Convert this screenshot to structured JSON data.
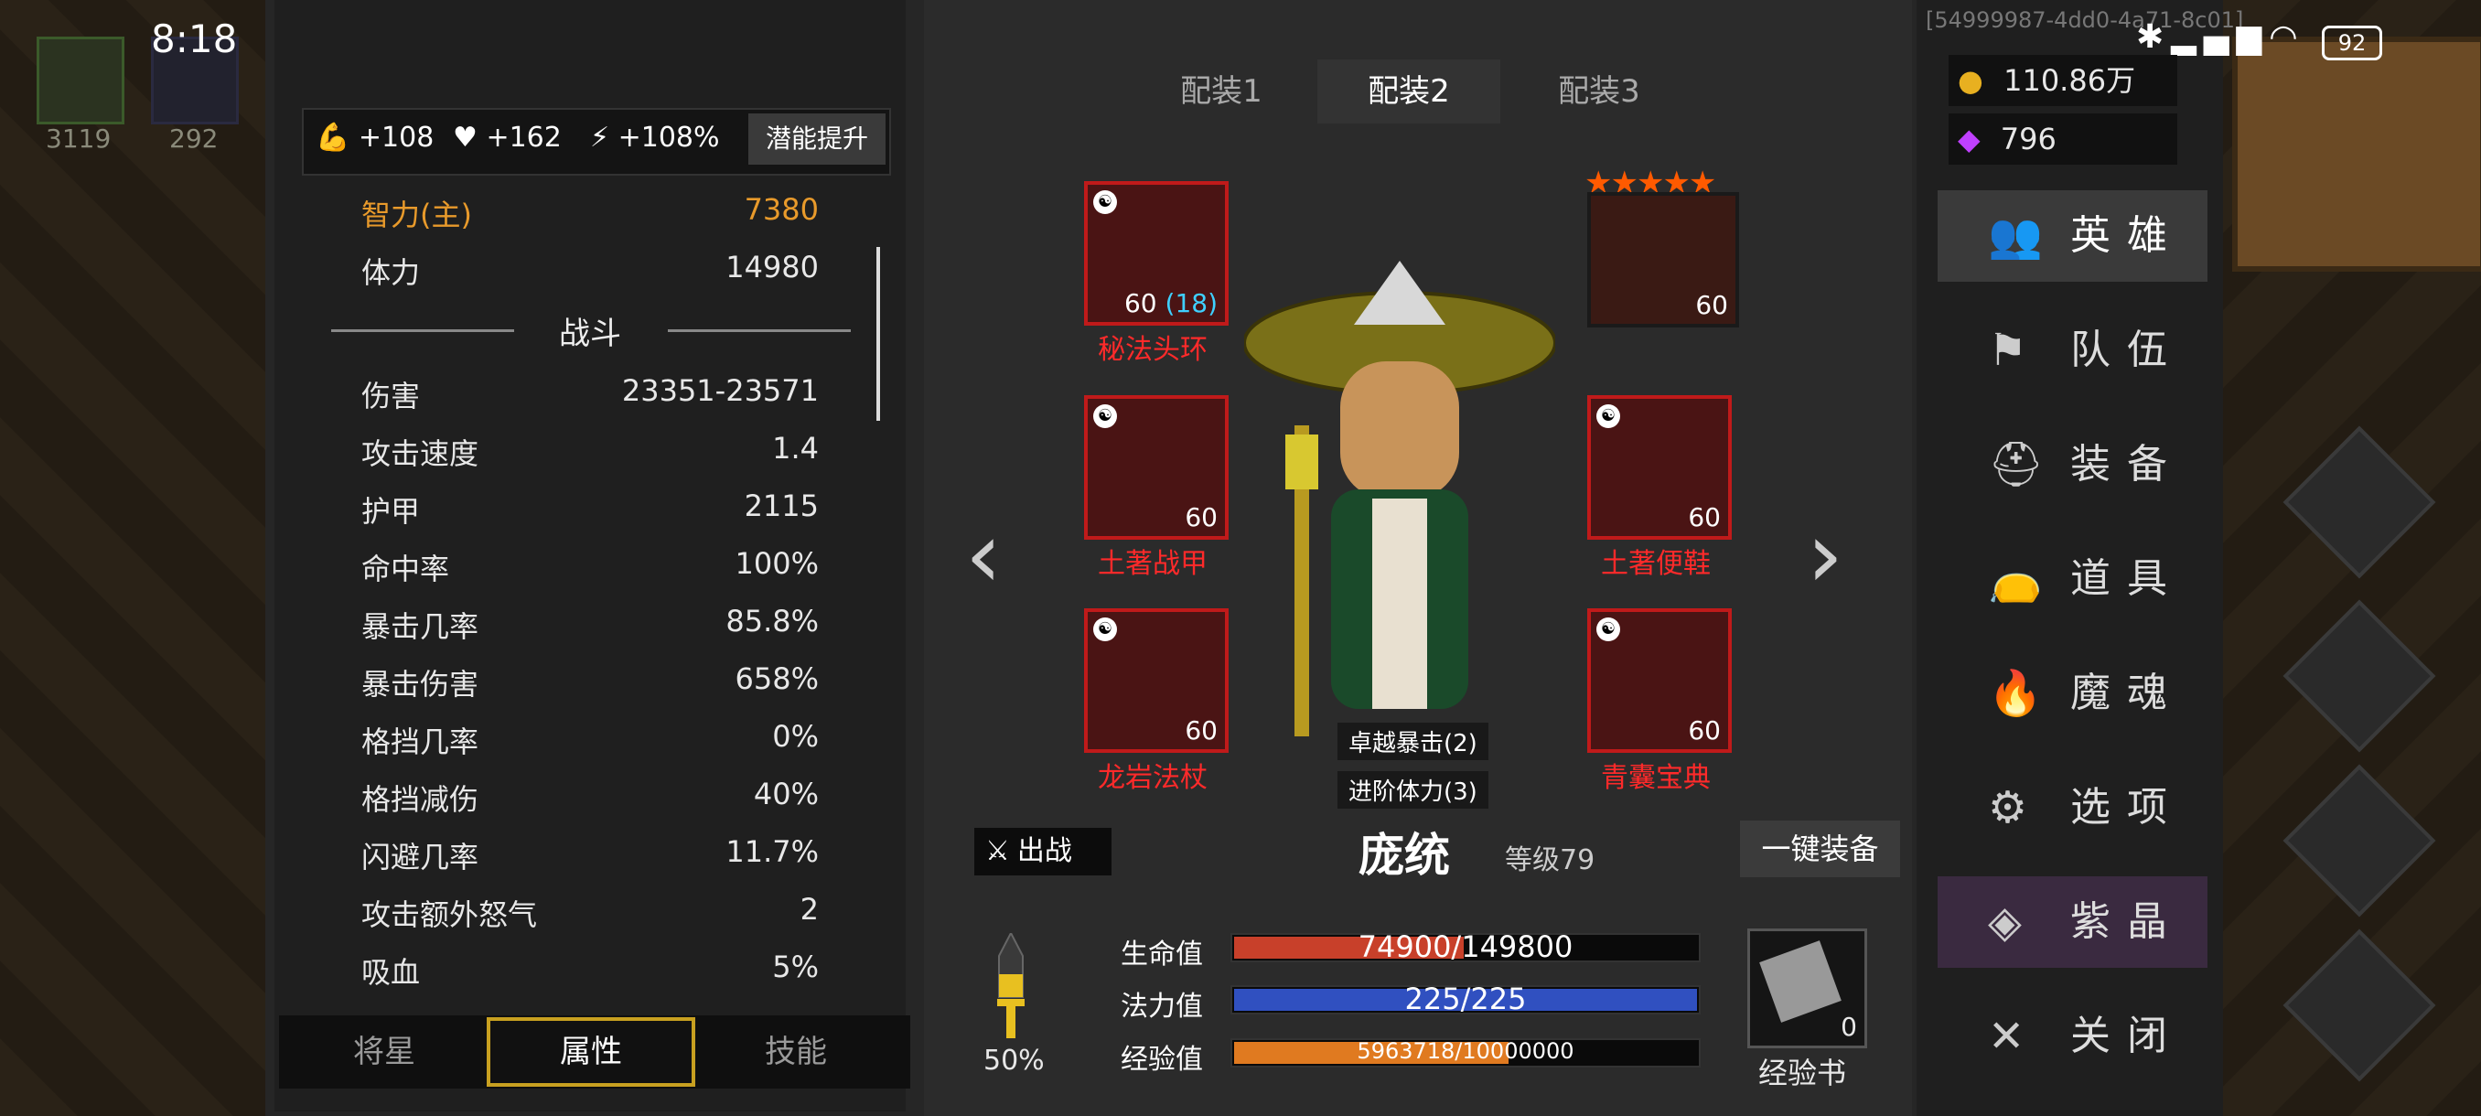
{
  "status": {
    "time": "8:18",
    "session_id": "[54999987-4dd0-4a71-8c01]",
    "battery": "92"
  },
  "background": {
    "item1_count": "3119",
    "item2_count": "292"
  },
  "stat_bonus": {
    "str": "+108",
    "hp": "+162",
    "spd": "+108%",
    "potential_button": "潜能提升"
  },
  "attributes": {
    "int_main": {
      "label": "智力(主)",
      "value": "7380"
    },
    "stamina": {
      "label": "体力",
      "value": "14980"
    },
    "combat_title": "战斗",
    "rows": [
      {
        "label": "伤害",
        "value": "23351-23571"
      },
      {
        "label": "攻击速度",
        "value": "1.4"
      },
      {
        "label": "护甲",
        "value": "2115"
      },
      {
        "label": "命中率",
        "value": "100%"
      },
      {
        "label": "暴击几率",
        "value": "85.8%"
      },
      {
        "label": "暴击伤害",
        "value": "658%"
      },
      {
        "label": "格挡几率",
        "value": "0%"
      },
      {
        "label": "格挡减伤",
        "value": "40%"
      },
      {
        "label": "闪避几率",
        "value": "11.7%"
      },
      {
        "label": "攻击额外怒气",
        "value": "2"
      },
      {
        "label": "吸血",
        "value": "5%"
      }
    ]
  },
  "left_tabs": [
    "将星",
    "属性",
    "技能"
  ],
  "loadouts": [
    "配装1",
    "配装2",
    "配装3"
  ],
  "equipment": {
    "headband": {
      "name": "秘法头环",
      "level": "60",
      "bonus": "(18)"
    },
    "pet": {
      "level": "60"
    },
    "armor": {
      "name": "土著战甲",
      "level": "60"
    },
    "boots": {
      "name": "土著便鞋",
      "level": "60"
    },
    "staff": {
      "name": "龙岩法杖",
      "level": "60"
    },
    "book": {
      "name": "青囊宝典",
      "level": "60"
    }
  },
  "hero": {
    "tag1": "卓越暴击(2)",
    "tag2": "进阶体力(3)",
    "name": "庞统",
    "level": "等级79",
    "battle_button": "出战",
    "equip_all_button": "一键装备"
  },
  "bars": {
    "hp": {
      "label": "生命值",
      "text": "74900/149800",
      "fraction": 0.5
    },
    "mp": {
      "label": "法力值",
      "text": "225/225",
      "fraction": 1.0
    },
    "xp": {
      "label": "经验值",
      "text": "5963718/10000000",
      "fraction": 0.596
    }
  },
  "sword_percent": "50%",
  "xp_book": {
    "label": "经验书",
    "count": "0"
  },
  "currency": {
    "gold": "110.86万",
    "gems": "796"
  },
  "menu": [
    "英雄",
    "队伍",
    "装备",
    "道具",
    "魔魂",
    "选项",
    "紫晶",
    "关闭"
  ],
  "colors": {
    "accent_gold": "#c8a020",
    "item_red": "#c01a1a",
    "name_red": "#ff2a2a",
    "main_attr": "#e89a2b"
  }
}
